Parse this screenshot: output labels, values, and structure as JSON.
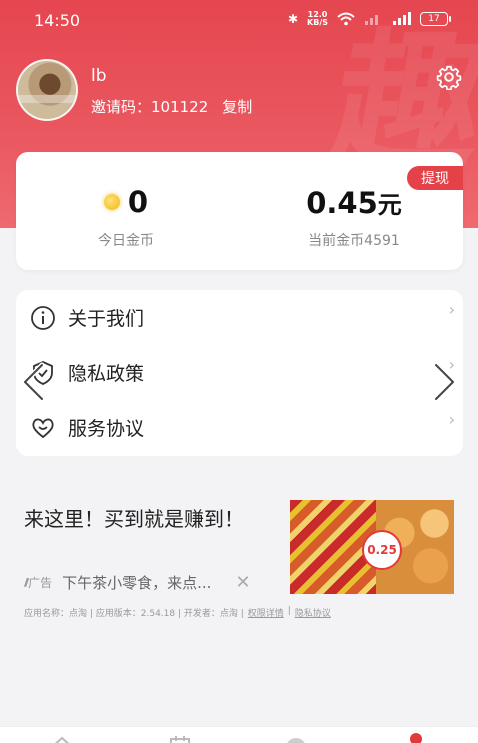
{
  "status_bar": {
    "time": "14:50",
    "speed_value": "12.0",
    "speed_unit": "KB/S",
    "battery": "17"
  },
  "profile": {
    "username": "lb",
    "invite_label": "邀请码：101122",
    "copy_label": "复制"
  },
  "coins": {
    "today_value": "0",
    "today_label": "今日金币",
    "balance_value": "0.45",
    "balance_unit": "元",
    "balance_label": "当前金币4591",
    "withdraw_label": "提现"
  },
  "menu": {
    "items": [
      {
        "label": "关于我们",
        "icon": "info-icon"
      },
      {
        "label": "隐私政策",
        "icon": "shield-icon"
      },
      {
        "label": "服务协议",
        "icon": "heart-icon"
      }
    ]
  },
  "ad": {
    "title": "来这里！买到就是赚到！",
    "tag": "广告",
    "description": "下午茶小零食，来点...",
    "price_badge": "0.25",
    "footer": "应用名称：点淘 | 应用版本：2.54.18 | 开发者：点淘 |",
    "permissions_link": "权限详情",
    "privacy_link": "隐私协议"
  },
  "colors": {
    "header_red": "#e5464f",
    "accent_red": "#e44148",
    "coin_gold": "#f3b40b"
  }
}
